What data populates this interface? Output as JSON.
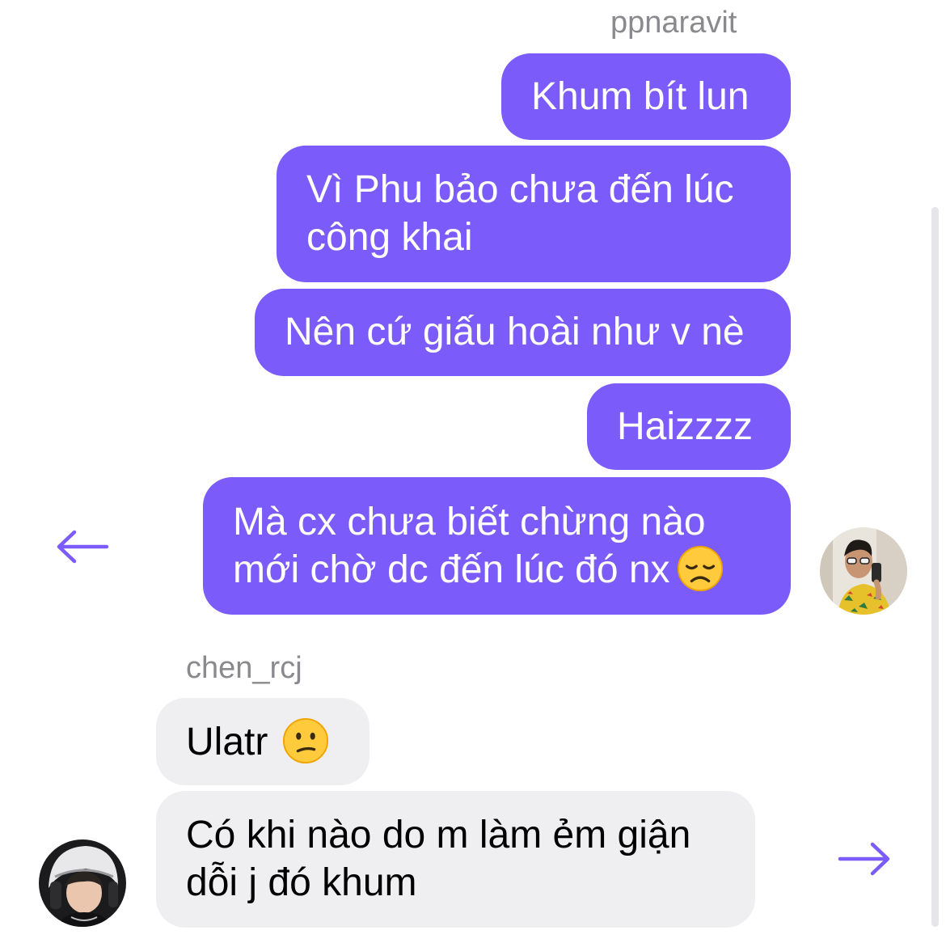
{
  "theme": {
    "accent": "#7b5cfa",
    "outgoing_bubble": "#7b5cfa",
    "incoming_bubble": "#efeff1",
    "sender_name_color": "#8a8a8e"
  },
  "thread": {
    "outgoing_sender": "ppnaravit",
    "incoming_sender": "chen_rcj",
    "outgoing_messages": [
      {
        "lines": [
          "Khum bít lun"
        ]
      },
      {
        "lines": [
          "Vì Phu bảo chưa đến lúc",
          "công khai"
        ]
      },
      {
        "lines": [
          "Nên cứ giấu hoài như v nè"
        ]
      },
      {
        "lines": [
          "Haizzzz"
        ]
      },
      {
        "lines": [
          "Mà cx chưa biết chừng nào",
          "mới chờ dc đến lúc đó nx"
        ],
        "emoji": "disappointed-face"
      }
    ],
    "incoming_messages": [
      {
        "lines": [
          "Ulatr"
        ],
        "emoji": "confused-face"
      },
      {
        "lines": [
          "Có khi nào do m làm ẻm giận",
          "dỗi j đó khum"
        ]
      }
    ]
  },
  "icons": {
    "reply_left": "arrow-left-icon",
    "reply_right": "arrow-right-icon"
  }
}
